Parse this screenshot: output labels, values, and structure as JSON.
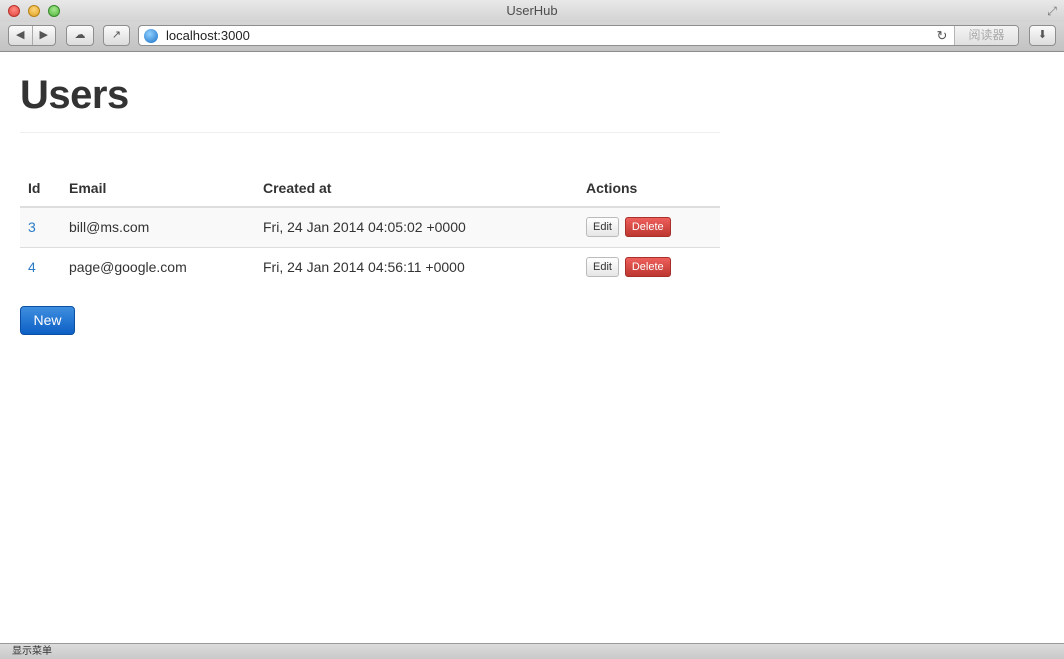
{
  "window": {
    "title": "UserHub"
  },
  "toolbar": {
    "url": "localhost:3000",
    "reader_label": "阅读器",
    "back_glyph": "◀",
    "forward_glyph": "▶",
    "reload_glyph": "↻",
    "cloud_glyph": "☁",
    "share_glyph": "↗",
    "download_glyph": "⬇",
    "fullscreen_glyph": "⤢"
  },
  "page": {
    "title": "Users",
    "columns": {
      "id": "Id",
      "email": "Email",
      "created_at": "Created at",
      "actions": "Actions"
    },
    "rows": [
      {
        "id": "3",
        "email": "bill@ms.com",
        "created_at": "Fri, 24 Jan 2014 04:05:02 +0000",
        "edit_label": "Edit",
        "delete_label": "Delete"
      },
      {
        "id": "4",
        "email": "page@google.com",
        "created_at": "Fri, 24 Jan 2014 04:56:11 +0000",
        "edit_label": "Edit",
        "delete_label": "Delete"
      }
    ],
    "new_label": "New"
  },
  "statusbar": {
    "text": "显示菜单"
  },
  "colors": {
    "link": "#2a7cc7",
    "delete": "#c9302c",
    "primary": "#1a6fd0"
  }
}
